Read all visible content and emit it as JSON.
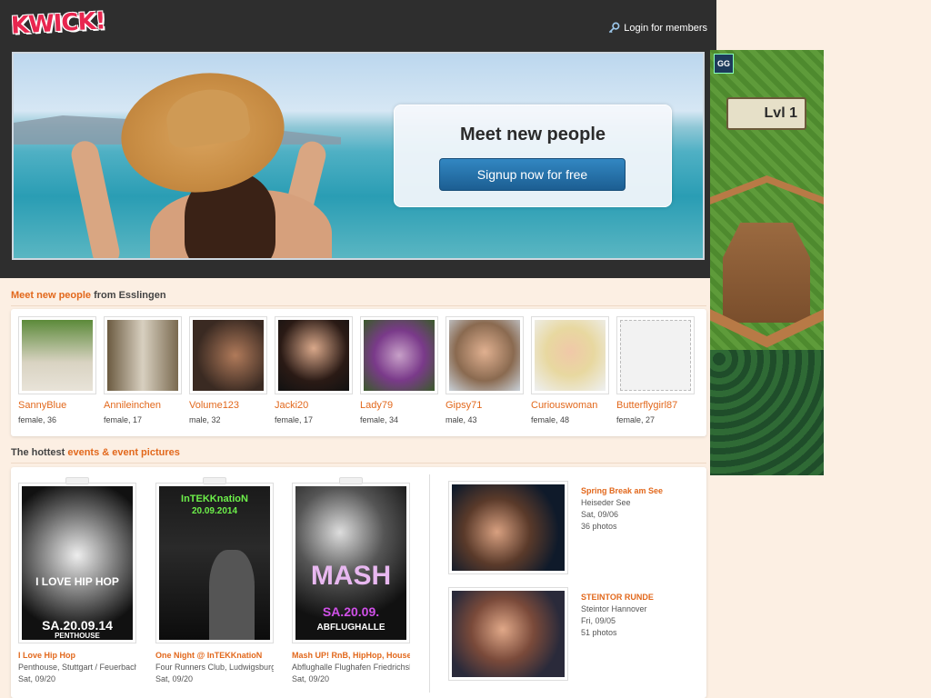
{
  "header": {
    "logo": "KWICK!",
    "login_label": "Login for members"
  },
  "hero": {
    "title": "Meet new people",
    "signup_label": "Signup now for free"
  },
  "people_section": {
    "title_highlight": "Meet new people",
    "title_rest": " from Esslingen",
    "people": [
      {
        "name": "SannyBlue",
        "info": "female, 36"
      },
      {
        "name": "Annileinchen",
        "info": "female, 17"
      },
      {
        "name": "Volume123",
        "info": "male, 32"
      },
      {
        "name": "Jacki20",
        "info": "female, 17"
      },
      {
        "name": "Lady79",
        "info": "female, 34"
      },
      {
        "name": "Gipsy71",
        "info": "male, 43"
      },
      {
        "name": "Curiouswoman",
        "info": "female, 48"
      },
      {
        "name": "Butterflygirl87",
        "info": "female, 27"
      }
    ]
  },
  "events_section": {
    "title_prefix": "The hottest ",
    "title_highlight": "events & event pictures",
    "events": [
      {
        "title": "I Love Hip Hop",
        "venue": "Penthouse, Stuttgart / Feuerbach",
        "date": "Sat, 09/20",
        "poster_top": "I LOVE HIP HOP",
        "poster_bottom": "SA.20.09.14",
        "poster_sub": "PENTHOUSE"
      },
      {
        "title": "One Night @ InTEKKnatioN",
        "venue": "Four Runners Club, Ludwigsburg",
        "date": "Sat, 09/20",
        "poster_top": "InTEKKnatioN",
        "poster_bottom": "20.09.2014",
        "poster_sub": ""
      },
      {
        "title": "Mash UP! RnB, HipHop, House",
        "venue": "Abflughalle Flughafen Friedrichshafen",
        "date": "Sat, 09/20",
        "poster_top": "MASH",
        "poster_bottom": "SA.20.09.",
        "poster_sub": "ABFLUGHALLE"
      }
    ],
    "picture_events": [
      {
        "title": "Spring Break am See",
        "venue": "Heiseder See",
        "date": "Sat, 09/06",
        "photos": "36 photos"
      },
      {
        "title": "STEINTOR RUNDE",
        "venue": "Steintor Hannover",
        "date": "Fri, 09/05",
        "photos": "51 photos"
      }
    ]
  },
  "ad": {
    "badge": "GG",
    "level": "Lvl 1"
  }
}
